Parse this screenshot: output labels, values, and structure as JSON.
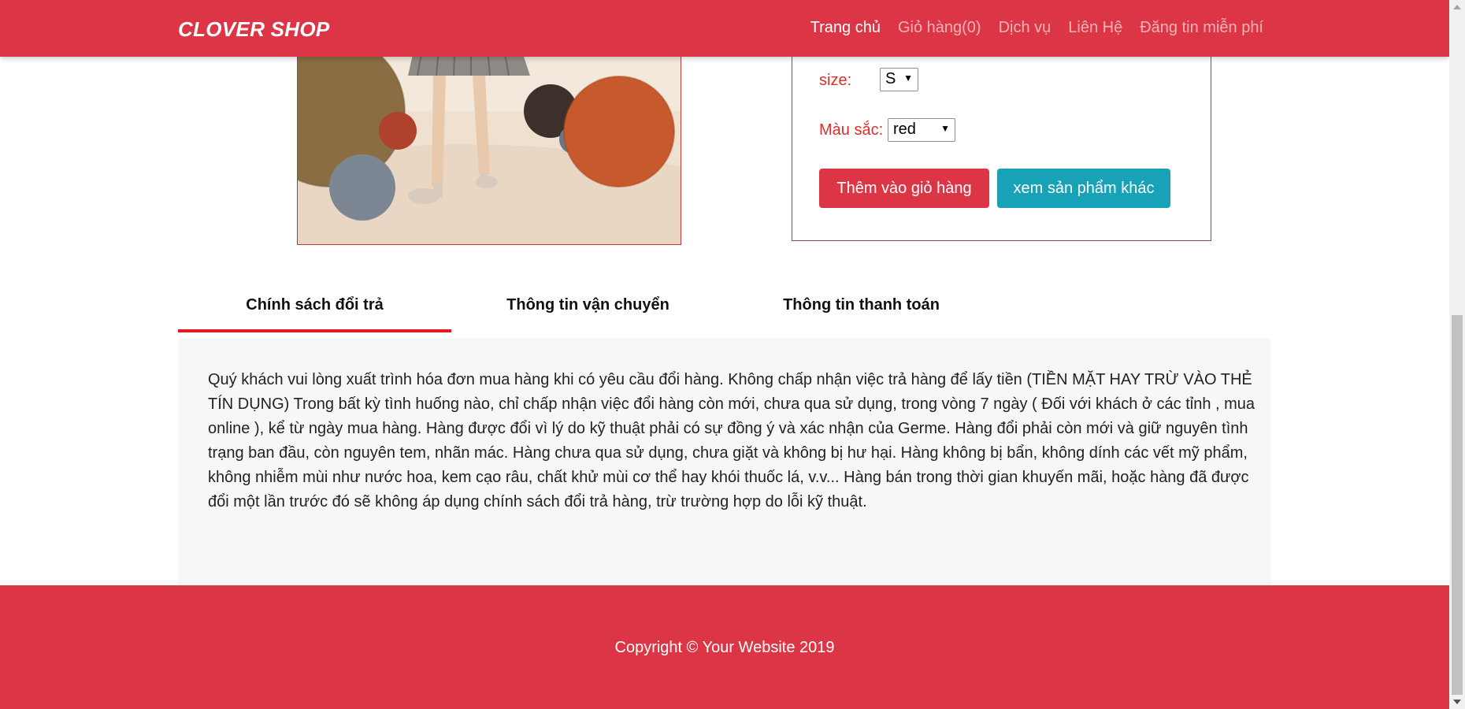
{
  "navbar": {
    "brand": "CLOVER SHOP",
    "links": [
      "Trang chủ",
      "Giỏ hàng(0)",
      "Dịch vụ",
      "Liên Hệ",
      "Đăng tin miễn phí"
    ],
    "active": "Trang chủ",
    "color": "#dc3545"
  },
  "product": {
    "image_alt": "product-photo"
  },
  "options": {
    "size_label": "size:",
    "size_value": "S",
    "color_label": "Màu sắc:",
    "color_value": "red",
    "add_to_cart": "Thêm vào giỏ hàng",
    "view_other": "xem sản phẩm khác"
  },
  "tabs": {
    "items": [
      "Chính sách đổi trả",
      "Thông tin vận chuyển",
      "Thông tin thanh toán"
    ],
    "active_index": 0,
    "content": "Quý khách vui lòng xuất trình hóa đơn mua hàng khi có yêu cầu đổi hàng. Không chấp nhận việc trả hàng để lấy tiền (TIỀN MẶT HAY TRỪ VÀO THẺ TÍN DỤNG) Trong bất kỳ tình huống nào, chỉ chấp nhận việc đổi hàng còn mới, chưa qua sử dụng, trong vòng 7 ngày ( Đối với khách ở các tỉnh , mua online ), kể từ ngày mua hàng. Hàng được đổi vì lý do kỹ thuật phải có sự đồng ý và xác nhận của Germe. Hàng đổi phải còn mới và giữ nguyên tình trạng ban đầu, còn nguyên tem, nhãn mác. Hàng chưa qua sử dụng, chưa giặt và không bị hư hại. Hàng không bị bẩn, không dính các vết mỹ phẩm, không nhiễm mùi như nước hoa, kem cạo râu, chất khử mùi cơ thể hay khói thuốc lá, v.v... Hàng bán trong thời gian khuyến mãi, hoặc hàng đã được đổi một lần trước đó sẽ không áp dụng chính sách đổi trả hàng, trừ trường hợp do lỗi kỹ thuật."
  },
  "footer": {
    "copyright": "Copyright © Your Website 2019"
  }
}
